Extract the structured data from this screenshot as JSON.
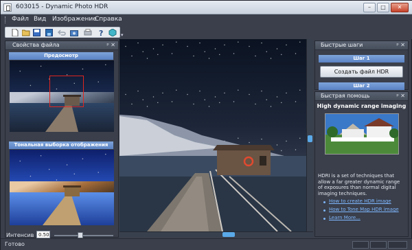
{
  "window": {
    "title": "603015 - Dynamic Photo HDR",
    "minimize": "–",
    "maximize": "□",
    "close": "✕"
  },
  "menu": [
    "Файл",
    "Вид",
    "Изображение",
    "Справка"
  ],
  "toolbar": {
    "icons": [
      "new-file-icon",
      "open-folder-icon",
      "save-icon",
      "save-as-icon",
      "undo-icon",
      "camera-icon",
      "print-icon",
      "help-icon",
      "hdr-cube-icon"
    ],
    "overflow": "▾"
  },
  "left_panel": {
    "title": "Свойства файла",
    "pin": "ᵖ",
    "close": "✕",
    "preview_label": "Предосмотр",
    "tonal_label": "Тональная выборка отображения",
    "intensity_label": "Интенсив",
    "intensity_value": "0.50"
  },
  "quick_steps": {
    "title": "Быстрые шаги",
    "step1": "Шаг 1",
    "create_button": "Создать файл HDR",
    "step2": "Шаг 2"
  },
  "quick_help": {
    "title": "Быстрая помощь",
    "heading": "High dynamic range imaging",
    "body": "HDRI is a set of techniques that allow a far greater dynamic range of exposures than normal digital imaging techniques.",
    "links": [
      "How to create HDR image",
      "How to Tone Map HDR image",
      "Learn More..."
    ]
  },
  "status": {
    "text": "Готово"
  }
}
